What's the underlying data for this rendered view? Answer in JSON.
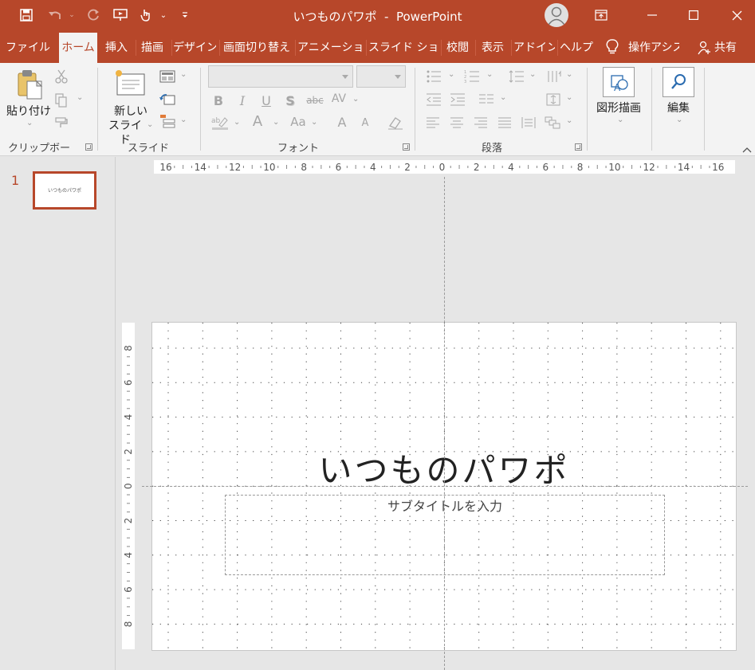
{
  "window": {
    "title": "いつものパワポ",
    "app": "PowerPoint"
  },
  "tabs": [
    {
      "label": "ファイル"
    },
    {
      "label": "ホーム"
    },
    {
      "label": "挿入"
    },
    {
      "label": "描画"
    },
    {
      "label": "デザイン"
    },
    {
      "label": "画面切り替え"
    },
    {
      "label": "アニメーション"
    },
    {
      "label": "スライド ショー"
    },
    {
      "label": "校閲"
    },
    {
      "label": "表示"
    },
    {
      "label": "アドイン"
    },
    {
      "label": "ヘルプ"
    }
  ],
  "tell_me": "操作アシス",
  "share": "共有",
  "ribbon": {
    "clipboard": {
      "paste": "貼り付け",
      "group": "クリップボード"
    },
    "slides": {
      "new_slide_line1": "新しい",
      "new_slide_line2": "スライド",
      "group": "スライド"
    },
    "font": {
      "group": "フォント",
      "bold": "B",
      "italic": "I",
      "underline": "U",
      "shadow": "S",
      "strike": "abc",
      "spacing": "AV",
      "color": "A",
      "case": "Aa",
      "grow": "A",
      "shrink": "A"
    },
    "paragraph": {
      "group": "段落"
    },
    "drawing": {
      "label": "図形描画"
    },
    "editing": {
      "label": "編集"
    }
  },
  "thumbnail": {
    "number": "1",
    "title": "いつものパワポ"
  },
  "slide": {
    "title": "いつものパワポ",
    "subtitle_placeholder": "サブタイトルを入力"
  },
  "hruler": {
    "labels": [
      "16",
      "14",
      "12",
      "10",
      "8",
      "6",
      "4",
      "2",
      "0",
      "2",
      "4",
      "6",
      "8",
      "10",
      "12",
      "14",
      "16"
    ]
  },
  "vruler": {
    "labels": [
      "8",
      "6",
      "4",
      "2",
      "0",
      "2",
      "4",
      "6",
      "8"
    ]
  },
  "colors": {
    "accent": "#b7472a",
    "ribbon_bg": "#f3f3f3",
    "workspace": "#e6e6e6"
  }
}
